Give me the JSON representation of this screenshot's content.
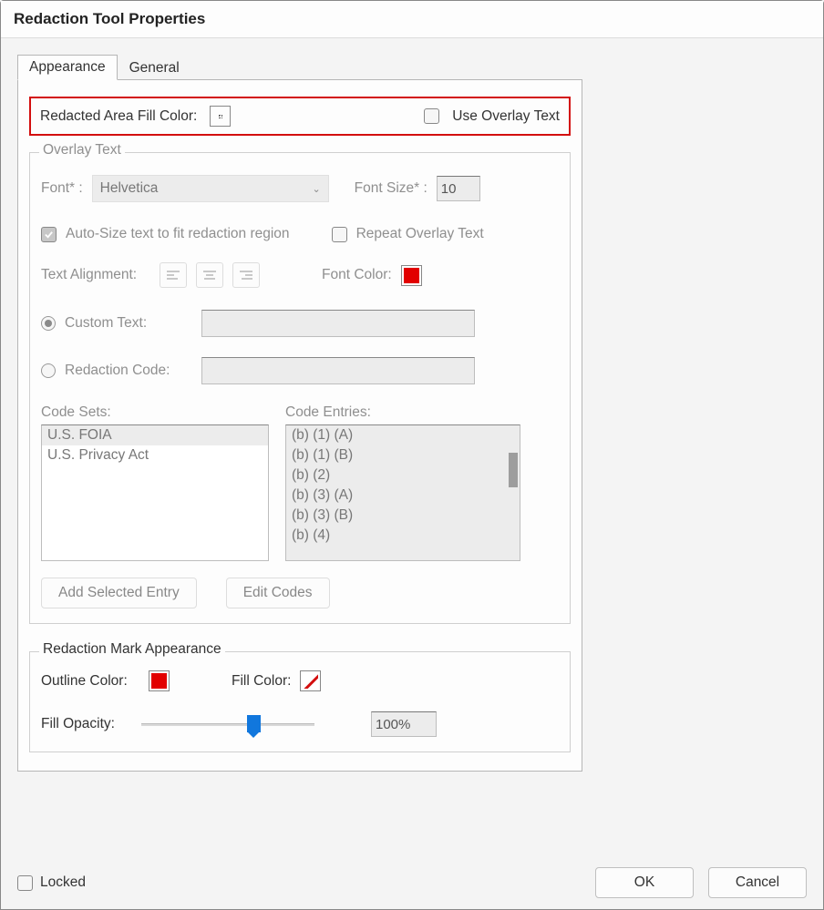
{
  "window_title": "Redaction Tool Properties",
  "tabs": {
    "appearance": "Appearance",
    "general": "General"
  },
  "appearance": {
    "fill_color_label": "Redacted Area Fill Color:",
    "fill_color": "#000000",
    "use_overlay_label": "Use Overlay Text"
  },
  "overlay": {
    "legend": "Overlay Text",
    "font_label": "Font* :",
    "font_value": "Helvetica",
    "font_size_label": "Font Size* :",
    "font_size_value": "10",
    "autosize_label": "Auto-Size text to fit redaction region",
    "repeat_label": "Repeat Overlay Text",
    "align_label": "Text Alignment:",
    "font_color_label": "Font Color:",
    "font_color": "#e20000",
    "custom_text_label": "Custom Text:",
    "redaction_code_label": "Redaction Code:",
    "code_sets_label": "Code Sets:",
    "code_entries_label": "Code Entries:",
    "code_sets": [
      "U.S. FOIA",
      "U.S. Privacy Act"
    ],
    "code_entries": [
      "(b) (1) (A)",
      "(b) (1) (B)",
      "(b) (2)",
      "(b) (3) (A)",
      "(b) (3) (B)",
      "(b) (4)"
    ],
    "add_entry_btn": "Add Selected Entry",
    "edit_codes_btn": "Edit Codes"
  },
  "mark": {
    "legend": "Redaction Mark Appearance",
    "outline_color_label": "Outline Color:",
    "outline_color": "#e20000",
    "fill_color_label": "Fill Color:",
    "fill_opacity_label": "Fill Opacity:",
    "opacity_value": "100%",
    "opacity_percent": 66
  },
  "footer": {
    "locked": "Locked",
    "ok": "OK",
    "cancel": "Cancel"
  }
}
